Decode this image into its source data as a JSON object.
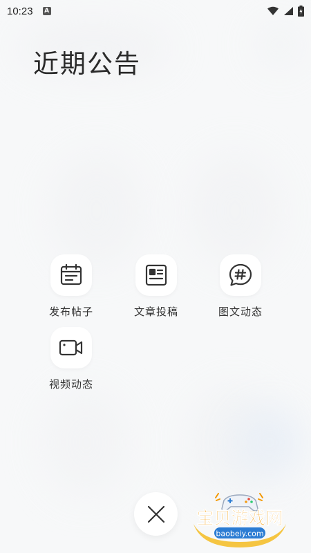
{
  "status_bar": {
    "time": "10:23",
    "icons": [
      "a-notification-icon",
      "wifi-icon",
      "cellular-signal-icon",
      "battery-charging-icon"
    ]
  },
  "header": {
    "title": "近期公告"
  },
  "actions": [
    {
      "label": "发布帖子",
      "icon": "post-calendar-icon"
    },
    {
      "label": "文章投稿",
      "icon": "article-icon"
    },
    {
      "label": "图文动态",
      "icon": "hashtag-bubble-icon"
    },
    {
      "label": "视频动态",
      "icon": "video-camera-icon"
    }
  ],
  "close_button": {
    "icon": "close-icon"
  },
  "watermark": {
    "title": "宝贝游戏网",
    "url": "baobeiy.com"
  },
  "colors": {
    "background": "#f7f8f9",
    "icon_stroke": "#333333",
    "watermark_orange": "#f39800",
    "watermark_blue": "#2b7cd3"
  }
}
